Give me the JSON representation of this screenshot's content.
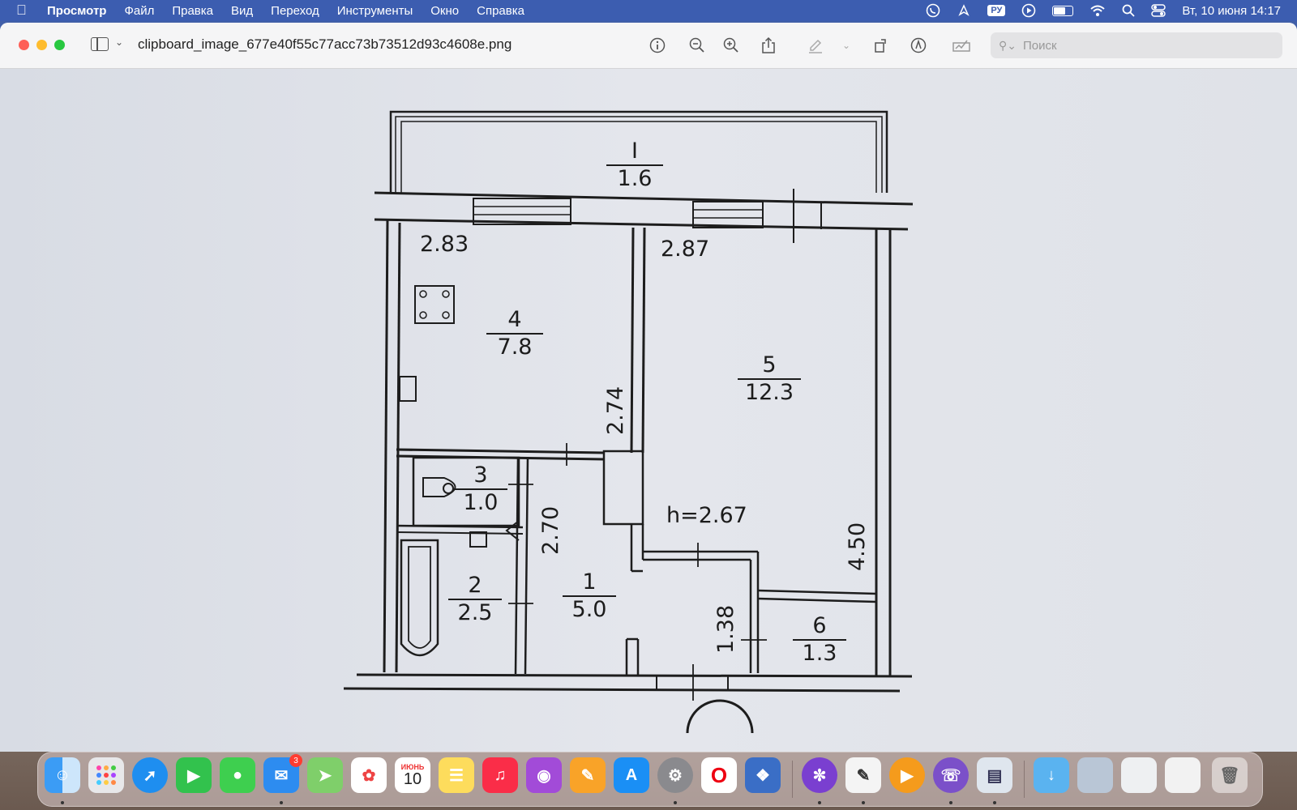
{
  "menubar": {
    "app_name": "Просмотр",
    "items": [
      "Файл",
      "Правка",
      "Вид",
      "Переход",
      "Инструменты",
      "Окно",
      "Справка"
    ],
    "keyboard_layout": "РУ",
    "clock": "Вт, 10 июня  14:17"
  },
  "window": {
    "title": "clipboard_image_677e40f55c77acc73b73512d93c4608e.png",
    "search_placeholder": "Поиск"
  },
  "floorplan": {
    "balcony": {
      "number": "I",
      "area": "1.6"
    },
    "dim_kitchen_width": "2.83",
    "dim_room_width": "2.87",
    "kitchen": {
      "number": "4",
      "area": "7.8"
    },
    "room": {
      "number": "5",
      "area": "12.3"
    },
    "dim_kitchen_depth": "2.74",
    "wc": {
      "number": "3",
      "area": "1.0"
    },
    "dim_hall_length": "2.70",
    "ceiling_height": "h=2.67",
    "dim_room_depth": "4.50",
    "bathroom": {
      "number": "2",
      "area": "2.5"
    },
    "hall": {
      "number": "1",
      "area": "5.0"
    },
    "dim_closet": "1.38",
    "closet": {
      "number": "6",
      "area": "1.3"
    }
  },
  "dock": {
    "calendar_month": "ИЮНЬ",
    "calendar_day": "10",
    "mail_badge": "3"
  },
  "colors": {
    "menubar": "#3c5db0",
    "close": "#fe5f57",
    "minimize": "#febc2e",
    "zoom": "#28c840"
  }
}
